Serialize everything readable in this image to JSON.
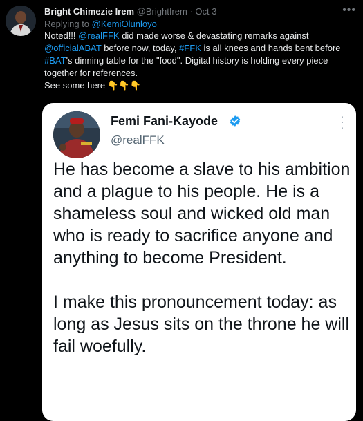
{
  "tweet": {
    "author_name": "Bright Chimezie Irem",
    "author_handle": "@BrightIrem",
    "separator": "·",
    "date": "Oct 3",
    "replying_prefix": "Replying to",
    "replying_to": "@KemiOlunloyo",
    "body": {
      "t1": "Noted!!! ",
      "m1": "@realFFK",
      "t2": " did made worse & devastating remarks against ",
      "m2": "@officialABAT",
      "t3": " before now, today, ",
      "h1": "#FFK",
      "t4": " is all knees and hands bent before ",
      "h2": "#BAT",
      "t5": "'s dinning table for the \"food\". Digital history is holding every piece together for references.",
      "line2": "See some here",
      "emoji": "👇👇👇"
    },
    "more_icon": "more-horizontal-icon"
  },
  "embedded": {
    "name": "Femi Fani-Kayode",
    "handle": "@realFFK",
    "verified_icon": "verified-badge-icon",
    "more_icon": "more-vertical-icon",
    "para1": "He has become a slave to his ambition and a plague to his people. He is a shameless soul and wicked old man who is ready to sacrifice anyone and anything to become President.",
    "para2": "I make this pronouncement today: as long as Jesus sits on the throne he will fail woefully."
  },
  "colors": {
    "background": "#000000",
    "text": "#e7e9ea",
    "muted": "#71767b",
    "link": "#1d9bf0",
    "card_bg": "#ffffff",
    "verified": "#1d9bf0"
  }
}
